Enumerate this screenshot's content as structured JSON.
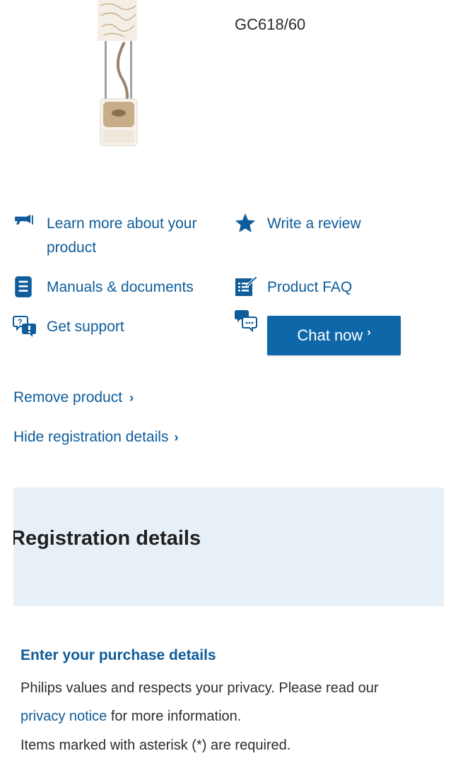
{
  "product": {
    "model": "GC618/60",
    "image_icon": "garment-steamer-product-image"
  },
  "actions": {
    "learn_more_line1": "Learn more about your",
    "learn_more_line2": "product",
    "write_review": "Write a review",
    "manuals": "Manuals & documents",
    "faq": "Product FAQ",
    "support": "Get support",
    "chat_now": "Chat now",
    "chat_chevron": "›"
  },
  "links": {
    "remove_product": "Remove product",
    "hide_registration": "Hide registration details",
    "chevron": "›"
  },
  "registration": {
    "title": "Registration details",
    "purchase_heading": "Enter your purchase details",
    "privacy_line1": "Philips values and respects your privacy. Please read our",
    "privacy_link": "privacy notice",
    "privacy_line2_rest": " for more information.",
    "required_note": "Items marked with asterisk (*) are required."
  },
  "colors": {
    "link": "#0e5c9a",
    "button": "#0d67a8",
    "band": "#e8f0f7"
  }
}
